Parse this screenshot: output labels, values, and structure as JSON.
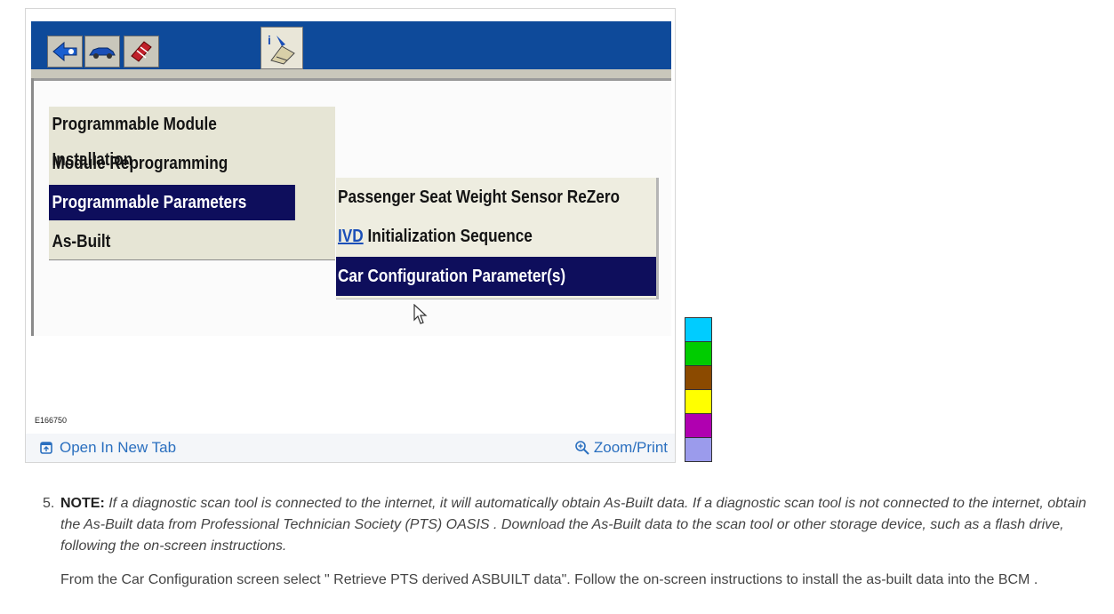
{
  "figure": {
    "menu_items": [
      {
        "label": "Programmable Module Installation"
      },
      {
        "label": "Module Reprogramming"
      },
      {
        "label": "Programmable Parameters"
      },
      {
        "label": "As-Built"
      }
    ],
    "submenu_items": [
      {
        "label": "Passenger Seat Weight Sensor ReZero"
      },
      {
        "prefix": "IVD",
        "label": " Initialization Sequence"
      },
      {
        "label": "Car Configuration Parameter(s)"
      }
    ],
    "figure_id": "E166750",
    "open_tab_label": "Open In New Tab",
    "zoom_label": "Zoom/Print"
  },
  "swatches": [
    "#00ccff",
    "#00cc00",
    "#8b4a00",
    "#ffff00",
    "#b000b0",
    "#9b9bec"
  ],
  "step": {
    "number": "5.",
    "note_label": "NOTE:",
    "note_text": " If a diagnostic scan tool is connected to the internet, it will automatically obtain As-Built data. If a diagnostic scan tool is not connected to the internet, obtain the As-Built data from Professional Technician Society (PTS) OASIS . Download the As-Built data to the scan tool or other storage device, such as a flash drive, following the on-screen instructions.",
    "instruction": "From the Car Configuration screen select \" Retrieve PTS derived ASBUILT data\". Follow the on-screen instructions to install the as-built data into the BCM ."
  }
}
